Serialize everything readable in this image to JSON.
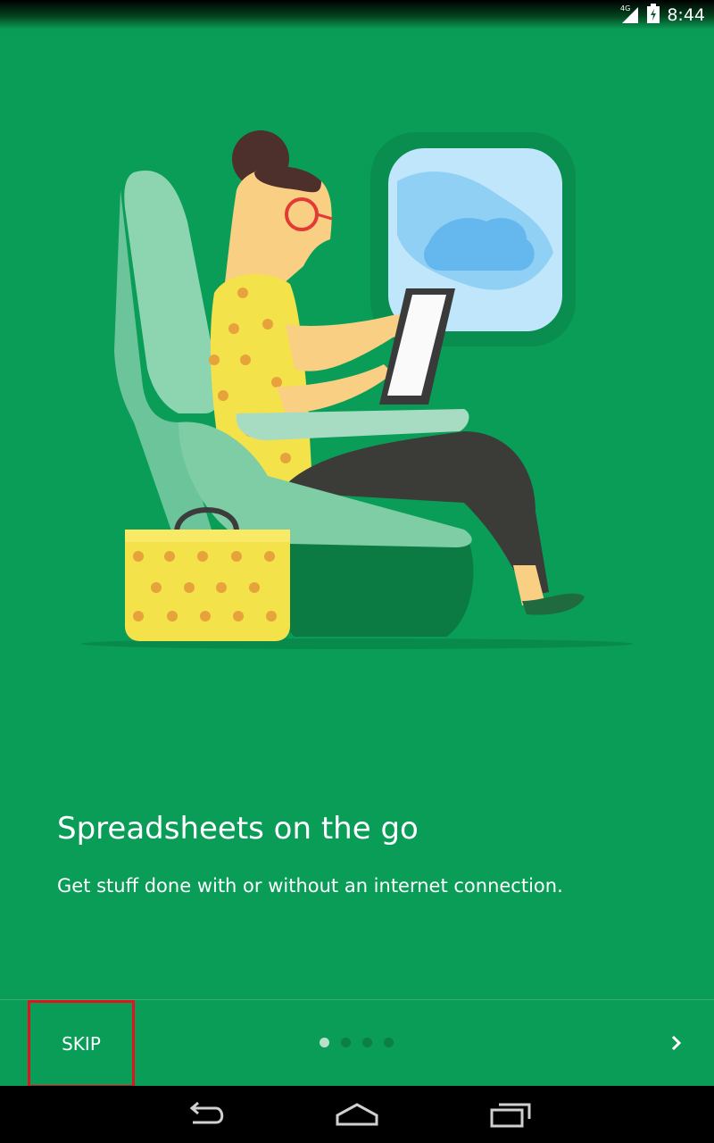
{
  "status_bar": {
    "time": "8:44",
    "network_label": "4G",
    "icons": [
      "signal-icon",
      "battery-icon"
    ]
  },
  "onboarding": {
    "title": "Spreadsheets on the go",
    "subtitle": "Get stuff done with or without an internet connection.",
    "illustration": "woman-on-airplane-illustration"
  },
  "bottom_bar": {
    "skip_label": "SKIP",
    "page_count": 4,
    "current_page": 1,
    "next_icon": "chevron-right-icon"
  },
  "nav_bar": {
    "buttons": [
      "back-icon",
      "home-icon",
      "recents-icon"
    ]
  },
  "colors": {
    "background": "#0a9d58",
    "highlight": "#e0141e",
    "dot_active": "#b7e2c9",
    "dot_inactive": "#0d7f46"
  }
}
